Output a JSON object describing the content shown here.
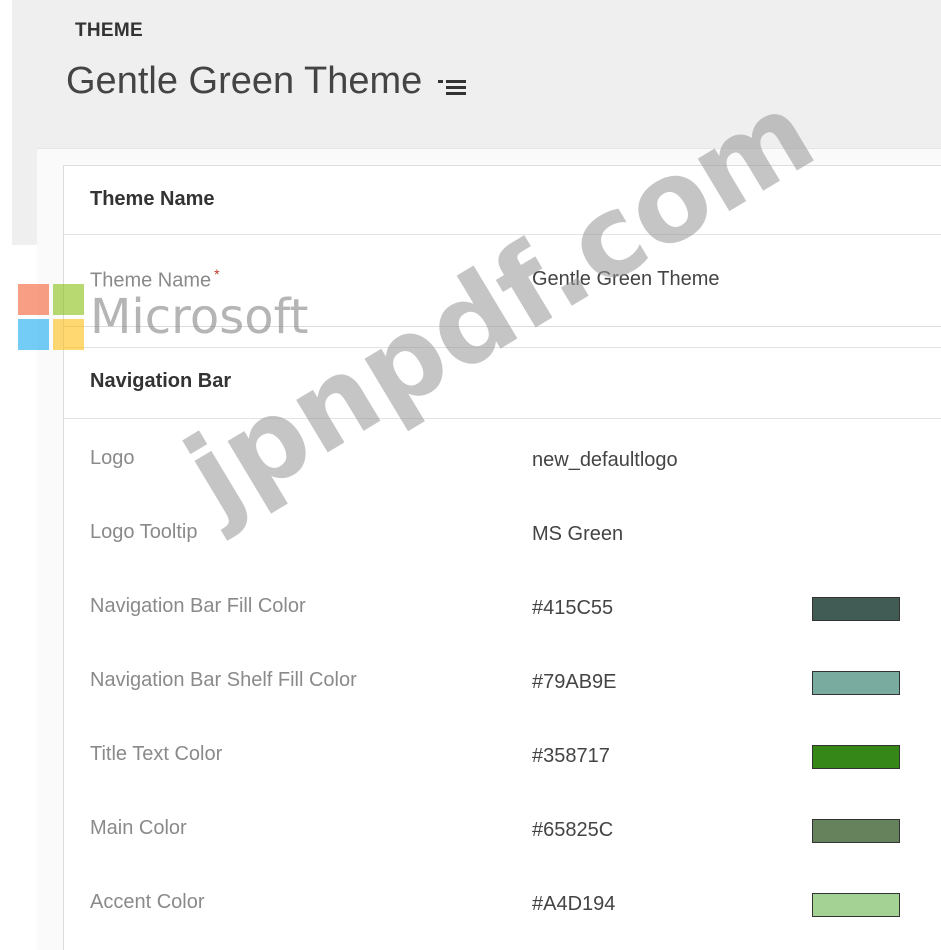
{
  "header": {
    "breadcrumb": "THEME",
    "title": "Gentle Green Theme",
    "menu_icon": "list-menu-icon"
  },
  "sections": {
    "theme_name_heading": "Theme Name",
    "navigation_bar_heading": "Navigation Bar"
  },
  "fields": {
    "theme_name": {
      "label": "Theme Name",
      "value": "Gentle Green Theme",
      "required_marker": "*"
    },
    "logo": {
      "label": "Logo",
      "value": "new_defaultlogo"
    },
    "logo_tooltip": {
      "label": "Logo Tooltip",
      "value": "MS Green"
    },
    "nav_bar_fill": {
      "label": "Navigation Bar Fill Color",
      "value": "#415C55",
      "swatch": "#415C55"
    },
    "nav_bar_shelf_fill": {
      "label": "Navigation Bar Shelf Fill Color",
      "value": "#79AB9E",
      "swatch": "#79AB9E"
    },
    "title_text": {
      "label": "Title Text Color",
      "value": "#358717",
      "swatch": "#358717"
    },
    "main_color": {
      "label": "Main Color",
      "value": "#65825C",
      "swatch": "#65825C"
    },
    "accent_color": {
      "label": "Accent Color",
      "value": "#A4D194",
      "swatch": "#A4D194"
    }
  },
  "watermark": {
    "brand": "Microsoft",
    "site": "jpnpdf.com",
    "tile_colors": [
      "#f25022",
      "#7fba00",
      "#00a4ef",
      "#ffb900"
    ]
  }
}
